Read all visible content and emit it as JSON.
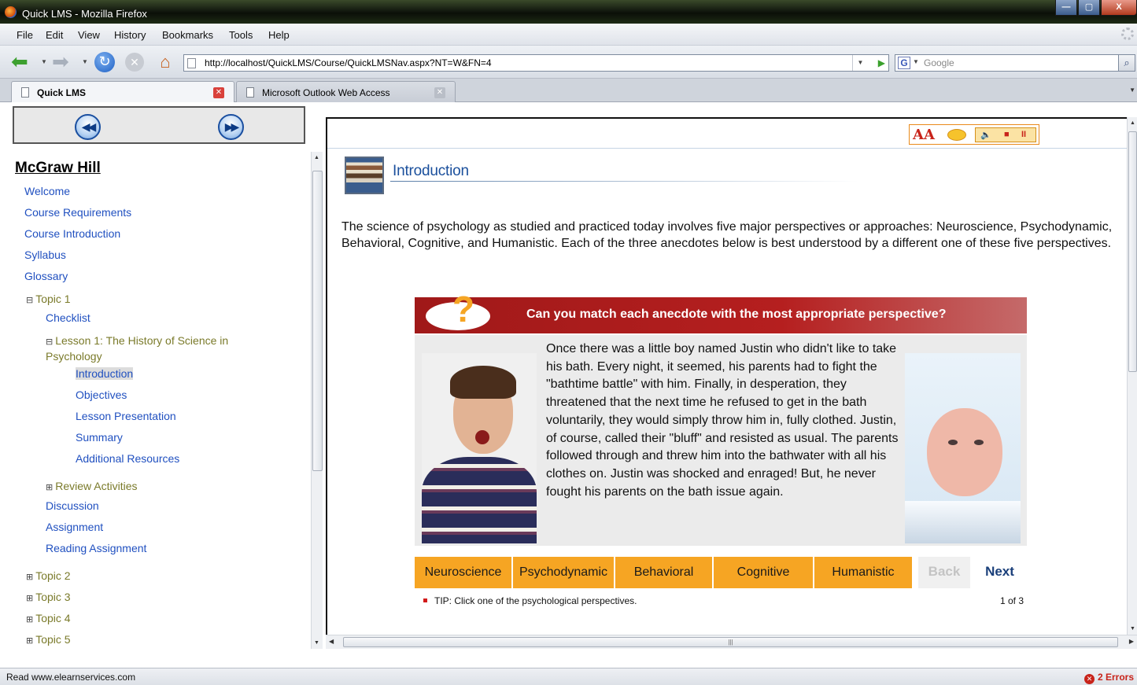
{
  "window": {
    "title": "Quick LMS - Mozilla Firefox",
    "controls": {
      "minimize": "—",
      "maximize": "▢",
      "close": "X"
    }
  },
  "menu": [
    "File",
    "Edit",
    "View",
    "History",
    "Bookmarks",
    "Tools",
    "Help"
  ],
  "toolbar": {
    "url": "http://localhost/QuickLMS/Course/QuickLMSNav.aspx?NT=W&FN=4",
    "search_placeholder": "Google",
    "search_engine_icon": "G"
  },
  "tabs": [
    {
      "label": "Quick LMS",
      "active": true
    },
    {
      "label": "Microsoft Outlook Web Access",
      "active": false
    }
  ],
  "sidebar": {
    "heading": "McGraw Hill",
    "prev_icon": "rewind-icon",
    "next_icon": "fast-forward-icon",
    "items": [
      {
        "label": "Welcome"
      },
      {
        "label": "Course Requirements"
      },
      {
        "label": "Course Introduction"
      },
      {
        "label": "Syllabus"
      },
      {
        "label": "Glossary"
      },
      {
        "label": "Topic 1",
        "expander": "⊟"
      },
      {
        "label": "Checklist"
      },
      {
        "label": "Lesson 1: The History of Science in Psychology",
        "expander": "⊟"
      },
      {
        "label": "Introduction",
        "selected": true
      },
      {
        "label": "Objectives"
      },
      {
        "label": "Lesson Presentation"
      },
      {
        "label": "Summary"
      },
      {
        "label": "Additional Resources"
      },
      {
        "label": "Review Activities",
        "expander": "⊞"
      },
      {
        "label": "Discussion"
      },
      {
        "label": "Assignment"
      },
      {
        "label": "Reading Assignment"
      },
      {
        "label": "Topic 2",
        "expander": "⊞"
      },
      {
        "label": "Topic 3",
        "expander": "⊞"
      },
      {
        "label": "Topic 4",
        "expander": "⊞"
      },
      {
        "label": "Topic 5",
        "expander": "⊞"
      }
    ]
  },
  "lesson": {
    "title": "Introduction",
    "tools": {
      "text_size": "AA",
      "audio_play": "🔈",
      "audio_stop": "■",
      "audio_pause": "II"
    },
    "intro": "The science of psychology as studied and practiced today involves five major perspectives or approaches: Neuroscience, Psychodynamic, Behavioral, Cognitive, and Humanistic. Each of the three anecdotes below is best understood by a different one of these five perspectives.",
    "activity": {
      "question_mark": "?",
      "question": "Can you match each anecdote with the most appropriate perspective?",
      "anecdote": "Once there was a little boy named Justin who didn't like to take his bath. Every night, it seemed, his parents had to fight the \"bathtime battle\" with him. Finally, in desperation, they threatened that the next time he refused to get in the bath voluntarily, they would simply throw him in, fully clothed.  Justin, of course, called their \"bluff\" and resisted as usual. The parents followed through and threw him into the bathwater with all his clothes on.  Justin was shocked and enraged! But, he never fought his parents on the bath issue again.",
      "choices": [
        "Neuroscience",
        "Psychodynamic",
        "Behavioral",
        "Cognitive",
        "Humanistic"
      ],
      "back_label": "Back",
      "next_label": "Next",
      "tip": "TIP: Click one of the psychological perspectives.",
      "pager": "1 of 3"
    }
  },
  "status": {
    "text": "Read www.elearnservices.com",
    "errors": "2 Errors"
  },
  "colors": {
    "link": "#2050c0",
    "banner_red": "#b51f1f",
    "choice_orange": "#f6a523",
    "title_blue": "#1a4f9c"
  }
}
